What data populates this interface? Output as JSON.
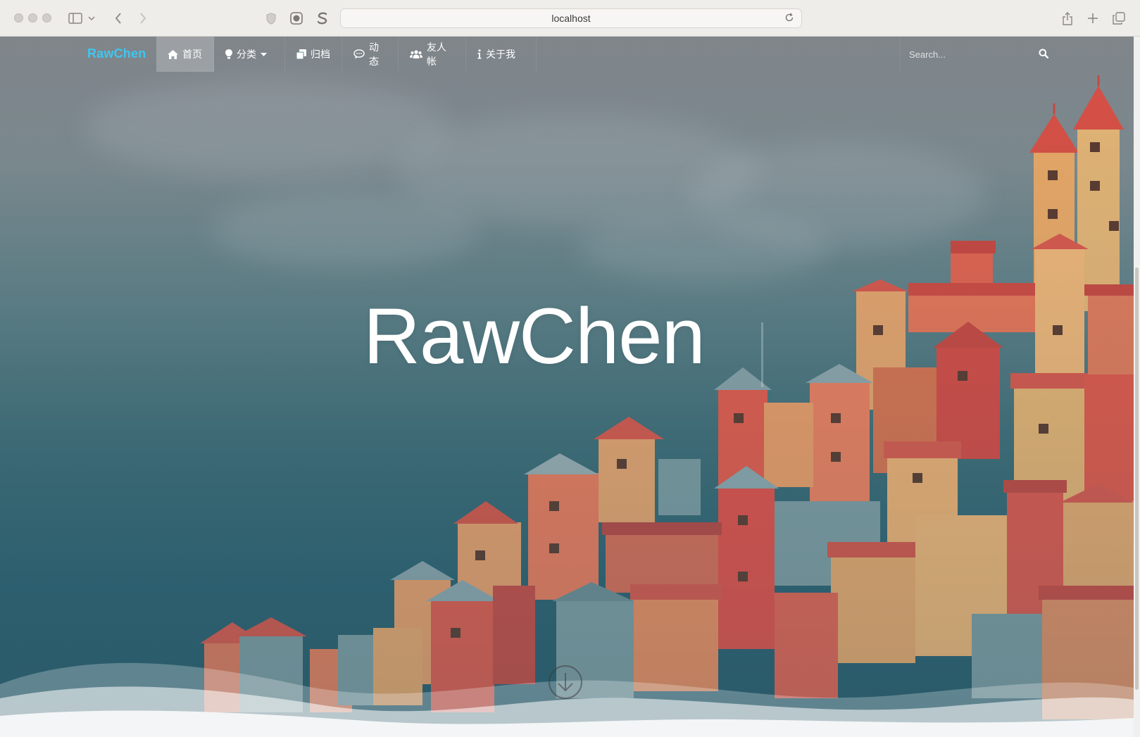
{
  "browser": {
    "url": "localhost"
  },
  "nav": {
    "brand": "RawChen",
    "items": [
      {
        "label": "首页",
        "icon": "home-icon",
        "active": true
      },
      {
        "label": "分类",
        "icon": "lightbulb-icon",
        "dropdown": true
      },
      {
        "label": "归档",
        "icon": "copy-icon"
      },
      {
        "label": "动态",
        "icon": "comment-icon"
      },
      {
        "label": "友人帐",
        "icon": "users-icon"
      },
      {
        "label": "关于我",
        "icon": "info-icon"
      }
    ],
    "search_placeholder": "Search..."
  },
  "hero": {
    "title": "RawChen"
  },
  "colors": {
    "brand": "#3ec6f0",
    "sky_top": "#80858a",
    "sky_bottom": "#2a5a69",
    "roof_red": "#e4584b",
    "wall_orange": "#e98d5c"
  }
}
